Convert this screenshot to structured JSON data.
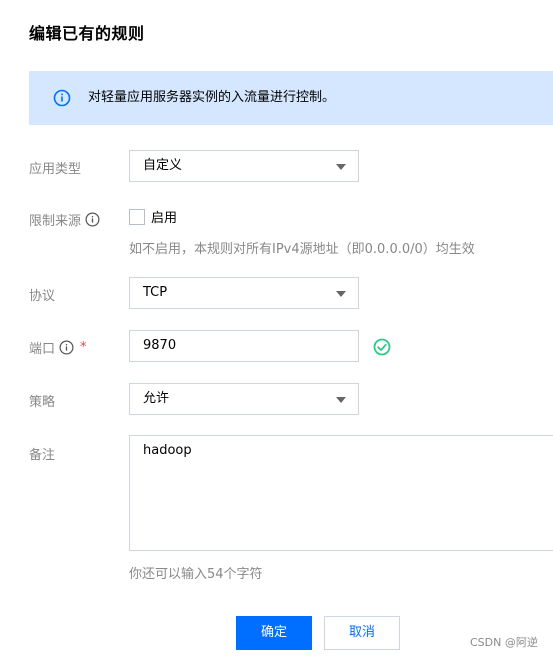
{
  "dialog": {
    "title": "编辑已有的规则",
    "banner_text": "对轻量应用服务器实例的入流量进行控制。"
  },
  "fields": {
    "app_type": {
      "label": "应用类型",
      "value": "自定义"
    },
    "restrict_source": {
      "label": "限制来源",
      "checkbox_label": "启用",
      "checked": false,
      "hint": "如不启用，本规则对所有IPv4源地址（即0.0.0.0/0）均生效"
    },
    "protocol": {
      "label": "协议",
      "value": "TCP"
    },
    "port": {
      "label": "端口",
      "required_mark": "*",
      "value": "9870",
      "valid": true
    },
    "policy": {
      "label": "策略",
      "value": "允许"
    },
    "remark": {
      "label": "备注",
      "value": "hadoop",
      "hint": "你还可以输入54个字符"
    }
  },
  "buttons": {
    "confirm": "确定",
    "cancel": "取消"
  },
  "watermark": "CSDN @阿逆",
  "colors": {
    "primary": "#006eff",
    "banner_bg": "#d5e7ff",
    "success": "#29cc85",
    "required": "#e54545"
  },
  "icons": {
    "banner": "info-icon",
    "help": "help-circle-icon",
    "valid": "check-circle-icon",
    "select": "caret-down-icon"
  }
}
